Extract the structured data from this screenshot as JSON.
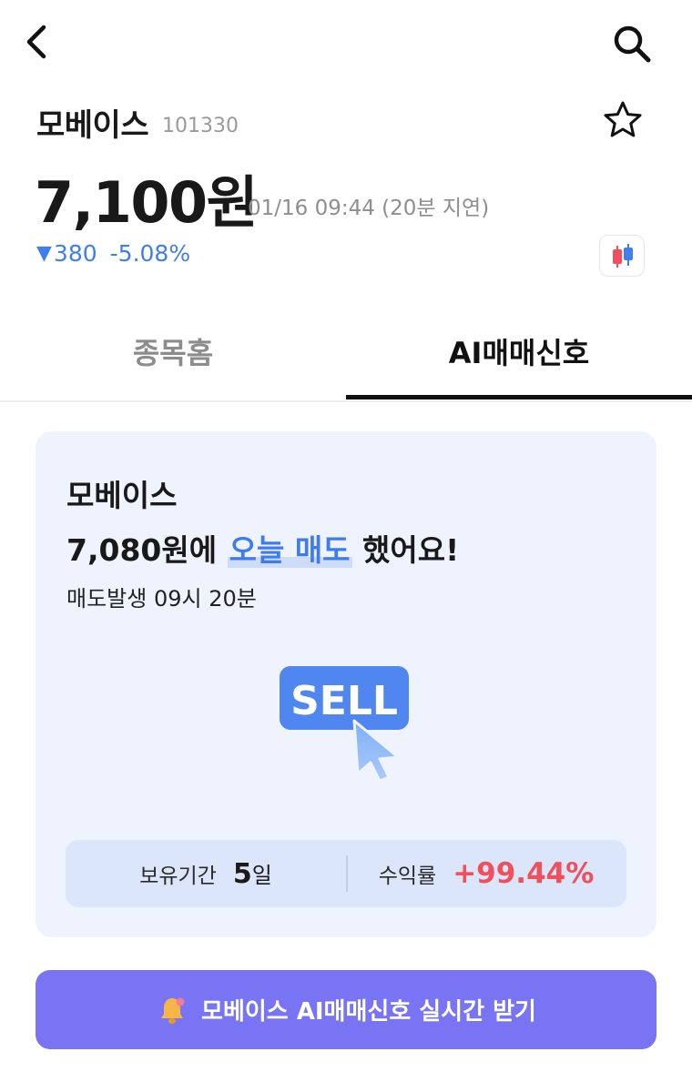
{
  "stock": {
    "name": "모베이스",
    "code": "101330",
    "price": "7,100원",
    "timestamp": "01/16 09:44 (20분 지연)",
    "change_arrow": "▼",
    "change_amount": "380",
    "change_percent": "-5.08%"
  },
  "tabs": [
    {
      "label": "종목홈",
      "active": false
    },
    {
      "label": "AI매매신호",
      "active": true
    }
  ],
  "signal_card": {
    "title": "모베이스",
    "price_text": "7,080원에",
    "action_text": "오늘 매도",
    "suffix_text": "했어요!",
    "occurred_text": "매도발생 09시 20분",
    "badge_text": "SELL",
    "holding_label": "보유기간",
    "holding_value": "5",
    "holding_unit": "일",
    "return_label": "수익률",
    "return_value": "+99.44%"
  },
  "cta": {
    "label": "모베이스 AI매매신호 실시간 받기"
  },
  "icons": {
    "back": "chevron-left-icon",
    "search": "search-icon",
    "star": "star-outline-icon",
    "chart": "candlestick-icon",
    "bell": "bell-icon",
    "cursor": "cursor-arrow-icon"
  },
  "colors": {
    "down": "#3f7ef0",
    "profit": "#f0505e",
    "card_bg": "#eff3fd",
    "stats_bg": "#dce6fb",
    "cta_bg": "#7874f3",
    "sell_badge": "#4f86f0"
  }
}
